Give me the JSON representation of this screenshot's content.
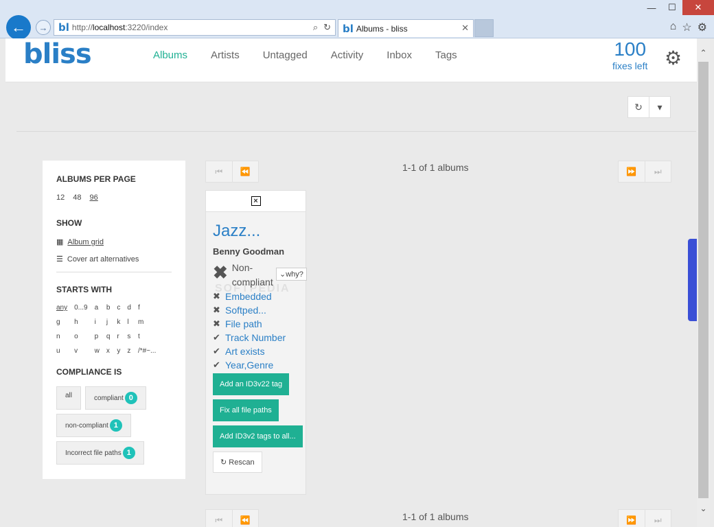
{
  "browser": {
    "url_prefix": "http://",
    "url_host": "localhost",
    "url_rest": ":3220/index",
    "favicon_text": "bl",
    "tab_title": "Albums - bliss",
    "win_minimize": "—",
    "win_maximize": "☐",
    "win_close": "✕",
    "back": "←",
    "forward": "→",
    "search_icon": "⌕",
    "refresh_icon": "↻",
    "close_tab": "✕",
    "home_icon": "⌂",
    "star_icon": "☆",
    "settings_icon": "⚙"
  },
  "header": {
    "logo": "bliss",
    "nav": [
      "Albums",
      "Artists",
      "Untagged",
      "Activity",
      "Inbox",
      "Tags"
    ],
    "active_nav": "Albums",
    "fixes_count": "100",
    "fixes_label": "fixes left",
    "gear_icon": "⚙"
  },
  "toolbar": {
    "refresh_icon": "↻",
    "dropdown_icon": "▾"
  },
  "sidebar": {
    "per_page_heading": "ALBUMS PER PAGE",
    "per_page": [
      "12",
      "48",
      "96"
    ],
    "show_heading": "SHOW",
    "album_grid": "Album grid",
    "cover_art": "Cover art alternatives",
    "starts_with_heading": "STARTS WITH",
    "letters": [
      "any",
      "0...9",
      "a",
      "b",
      "c",
      "d",
      "f",
      "g",
      "h",
      "i",
      "j",
      "k",
      "l",
      "m",
      "n",
      "o",
      "p",
      "q",
      "r",
      "s",
      "t",
      "u",
      "v",
      "w",
      "x",
      "y",
      "z",
      "/*#~..."
    ],
    "compliance_heading": "COMPLIANCE IS",
    "filter_all": "all",
    "filter_compliant": "compliant",
    "compliant_count": "0",
    "filter_noncompliant": "non-compliant",
    "noncompliant_count": "1",
    "filter_paths": "Incorrect file paths",
    "paths_count": "1"
  },
  "pager": {
    "first": "⏮",
    "prev": "⏪",
    "next": "⏩",
    "last": "⏭",
    "count": "1-1 of 1 albums"
  },
  "album": {
    "title": "Jazz...",
    "artist": "Benny Goodman",
    "status_line1": "Non-",
    "status_line2": "compliant",
    "why": "why?",
    "checks": [
      {
        "icon": "✖",
        "label": "Embedded"
      },
      {
        "icon": "✖",
        "label": "Softped..."
      },
      {
        "icon": "✖",
        "label": "File path"
      },
      {
        "icon": "✔",
        "label": "Track Number"
      },
      {
        "icon": "✔",
        "label": "Art exists"
      },
      {
        "icon": "✔",
        "label": "Year,Genre"
      }
    ],
    "btn_id3v22": "Add an ID3v22 tag",
    "btn_fix_paths": "Fix all file paths",
    "btn_id3v2_all": "Add ID3v2 tags to all...",
    "btn_rescan": "Rescan"
  },
  "watermark": "SOFTPEDIA",
  "colors": {
    "accent": "#1fb093",
    "brand": "#2a7fc6",
    "badge": "#1fc2b9"
  }
}
